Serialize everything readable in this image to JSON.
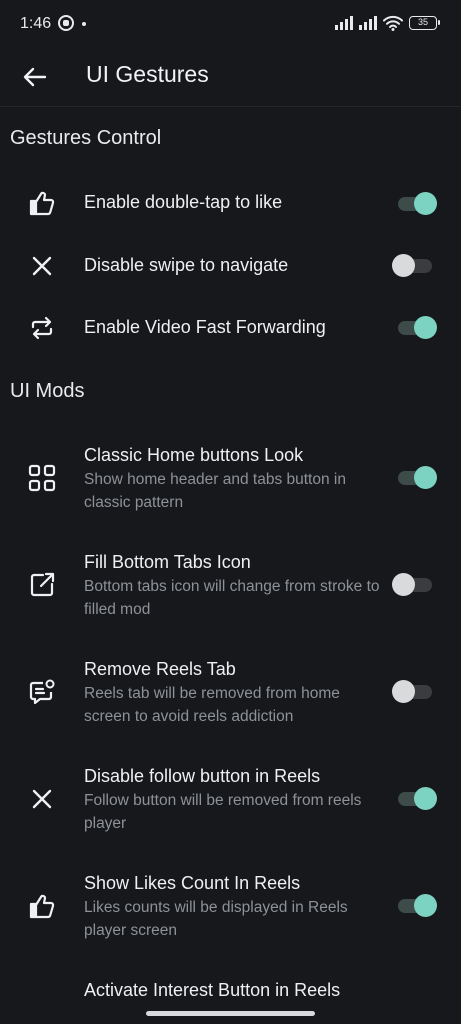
{
  "status_bar": {
    "time": "1:46",
    "battery": "35"
  },
  "header": {
    "title": "UI Gestures"
  },
  "sections": [
    {
      "title": "Gestures Control",
      "items": [
        {
          "icon": "thumbs-up-icon",
          "label": "Enable double-tap to like",
          "enabled": true
        },
        {
          "icon": "close-icon",
          "label": "Disable swipe to navigate",
          "enabled": false
        },
        {
          "icon": "repeat-icon",
          "label": "Enable Video Fast Forwarding",
          "enabled": true
        }
      ]
    },
    {
      "title": "UI Mods",
      "items": [
        {
          "icon": "grid-icon",
          "label": "Classic Home buttons Look",
          "description": "Show home header and tabs button in classic pattern",
          "enabled": true
        },
        {
          "icon": "external-link-icon",
          "label": "Fill Bottom Tabs Icon",
          "description": "Bottom tabs icon will change from stroke to filled mod",
          "enabled": false
        },
        {
          "icon": "message-alert-icon",
          "label": "Remove Reels Tab",
          "description": "Reels tab will be removed from home screen to avoid reels addiction",
          "enabled": false
        },
        {
          "icon": "close-icon",
          "label": "Disable follow button in Reels",
          "description": "Follow button will be removed from reels player",
          "enabled": true
        },
        {
          "icon": "thumbs-up-icon",
          "label": "Show Likes Count In Reels",
          "description": "Likes counts will be displayed in Reels player screen",
          "enabled": true
        },
        {
          "icon": "",
          "label": "Activate Interest Button in Reels"
        }
      ]
    }
  ],
  "colors": {
    "background": "#16181c",
    "accent": "#7dd3c1",
    "secondary_text": "#8e9297"
  }
}
